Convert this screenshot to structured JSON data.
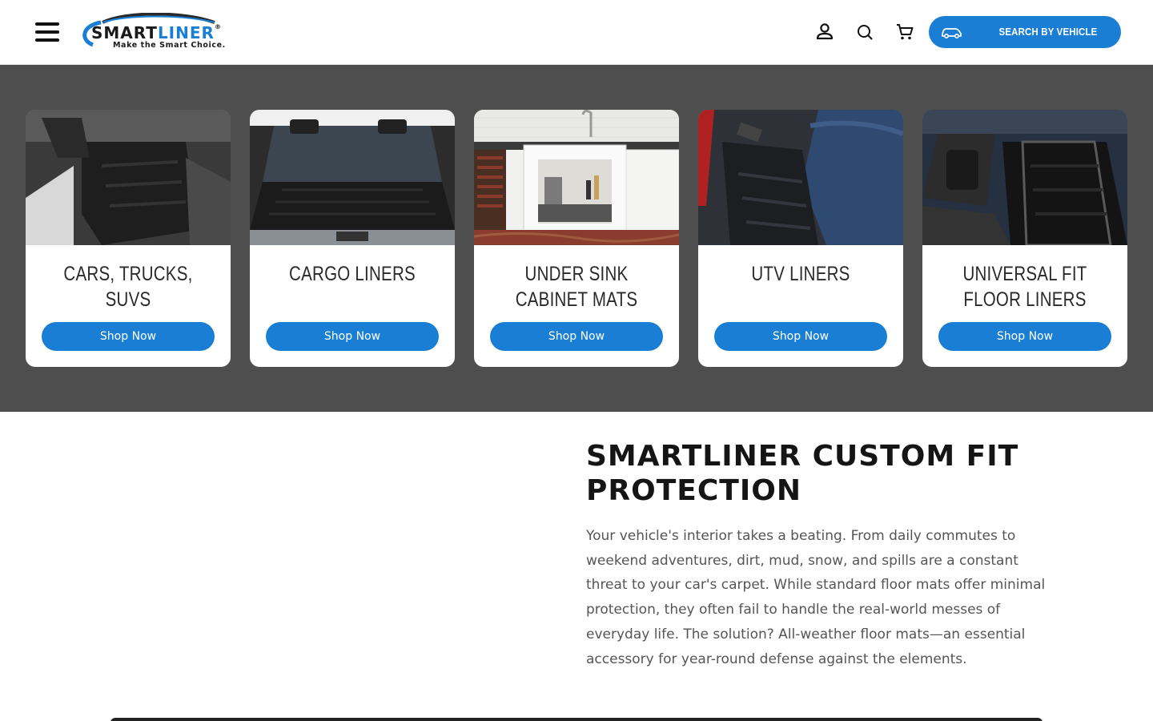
{
  "header": {
    "logo": {
      "brand_part1": "SMART",
      "brand_part2": "LINER",
      "reg_mark": "®",
      "tagline": "Make the Smart Choice."
    },
    "icons": {
      "menu": "hamburger-menu-icon",
      "account": "account-icon",
      "search": "search-icon",
      "cart": "cart-icon"
    },
    "vehicle_button_label": "SEARCH BY VEHICLE"
  },
  "categories": [
    {
      "title": "CARS, TRUCKS, SUVS",
      "button": "Shop Now"
    },
    {
      "title": "CARGO LINERS",
      "button": "Shop Now"
    },
    {
      "title": "UNDER SINK CABINET MATS",
      "button": "Shop Now"
    },
    {
      "title": "UTV LINERS",
      "button": "Shop Now"
    },
    {
      "title": "UNIVERSAL FIT FLOOR LINERS",
      "button": "Shop Now"
    }
  ],
  "content": {
    "heading": "SMARTLINER CUSTOM FIT PROTECTION",
    "body": "Your vehicle's interior takes a beating. From daily commutes to weekend adventures, dirt, mud, snow, and spills are a constant threat to your car's carpet. While standard floor mats offer minimal protection, they often fail to handle the real-world messes of everyday life. The solution? All-weather floor mats—an essential accessory for year-round defense against the elements."
  },
  "colors": {
    "accent": "#1a7fd4",
    "band": "#4e4e4e",
    "heading": "#151515",
    "body_text": "#555555"
  }
}
